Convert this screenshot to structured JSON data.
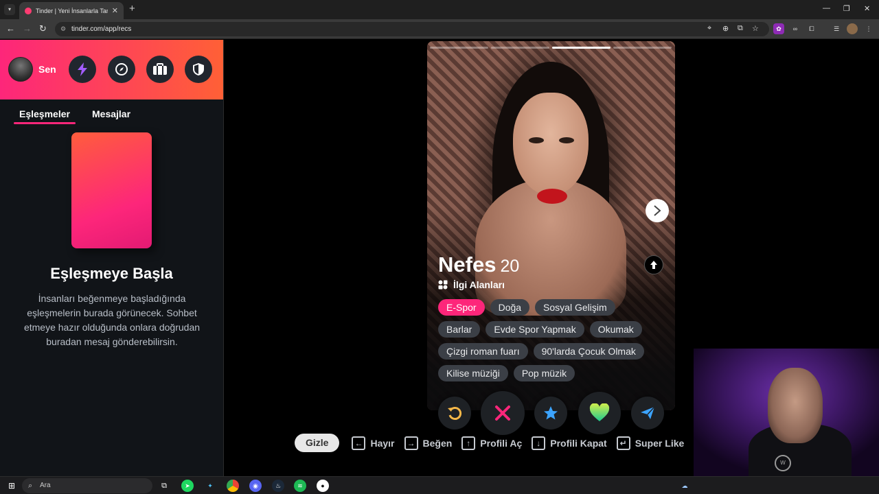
{
  "browser": {
    "tab_title": "Tinder | Yeni İnsanlarla Tanış, Bu",
    "tab_close": "✕",
    "new_tab": "+",
    "url": "tinder.com/app/recs"
  },
  "sidebar": {
    "me_label": "Sen",
    "tabs": [
      "Eşleşmeler",
      "Mesajlar"
    ],
    "empty_title": "Eşleşmeye Başla",
    "empty_desc": "İnsanları beğenmeye başladığında eşleşmelerin burada görünecek. Sohbet etmeye hazır olduğunda onlara doğrudan buradan mesaj gönderebilirsin."
  },
  "profile": {
    "name": "Nefes",
    "age": "20",
    "interests_title": "İlgi Alanları",
    "photo_count": 4,
    "active_photo": 3,
    "interests": [
      [
        "E-Spor",
        "Doğa",
        "Sosyal Gelişim"
      ],
      [
        "Barlar",
        "Evde Spor Yapmak",
        "Okumak"
      ],
      [
        "Çizgi roman fuarı",
        "90'larda Çocuk Olmak"
      ],
      [
        "Kilise müziği",
        "Pop müzik"
      ]
    ],
    "highlighted_interest": "E-Spor"
  },
  "actions": [
    "undo-icon",
    "nope-icon",
    "super-like-icon",
    "like-icon",
    "boost-icon"
  ],
  "shortcuts": {
    "hide_label": "Gizle",
    "items": [
      {
        "key": "←",
        "label": "Hayır"
      },
      {
        "key": "→",
        "label": "Beğen"
      },
      {
        "key": "↑",
        "label": "Profili Aç"
      },
      {
        "key": "↓",
        "label": "Profili Kapat"
      },
      {
        "key": "↵",
        "label": "Super Like"
      }
    ]
  },
  "taskbar": {
    "search_placeholder": "Ara"
  },
  "colors": {
    "brand_start": "#fd267a",
    "brand_end": "#ff6036",
    "like": "#1ec88f",
    "star": "#3ca4ff",
    "undo": "#f5b748"
  }
}
